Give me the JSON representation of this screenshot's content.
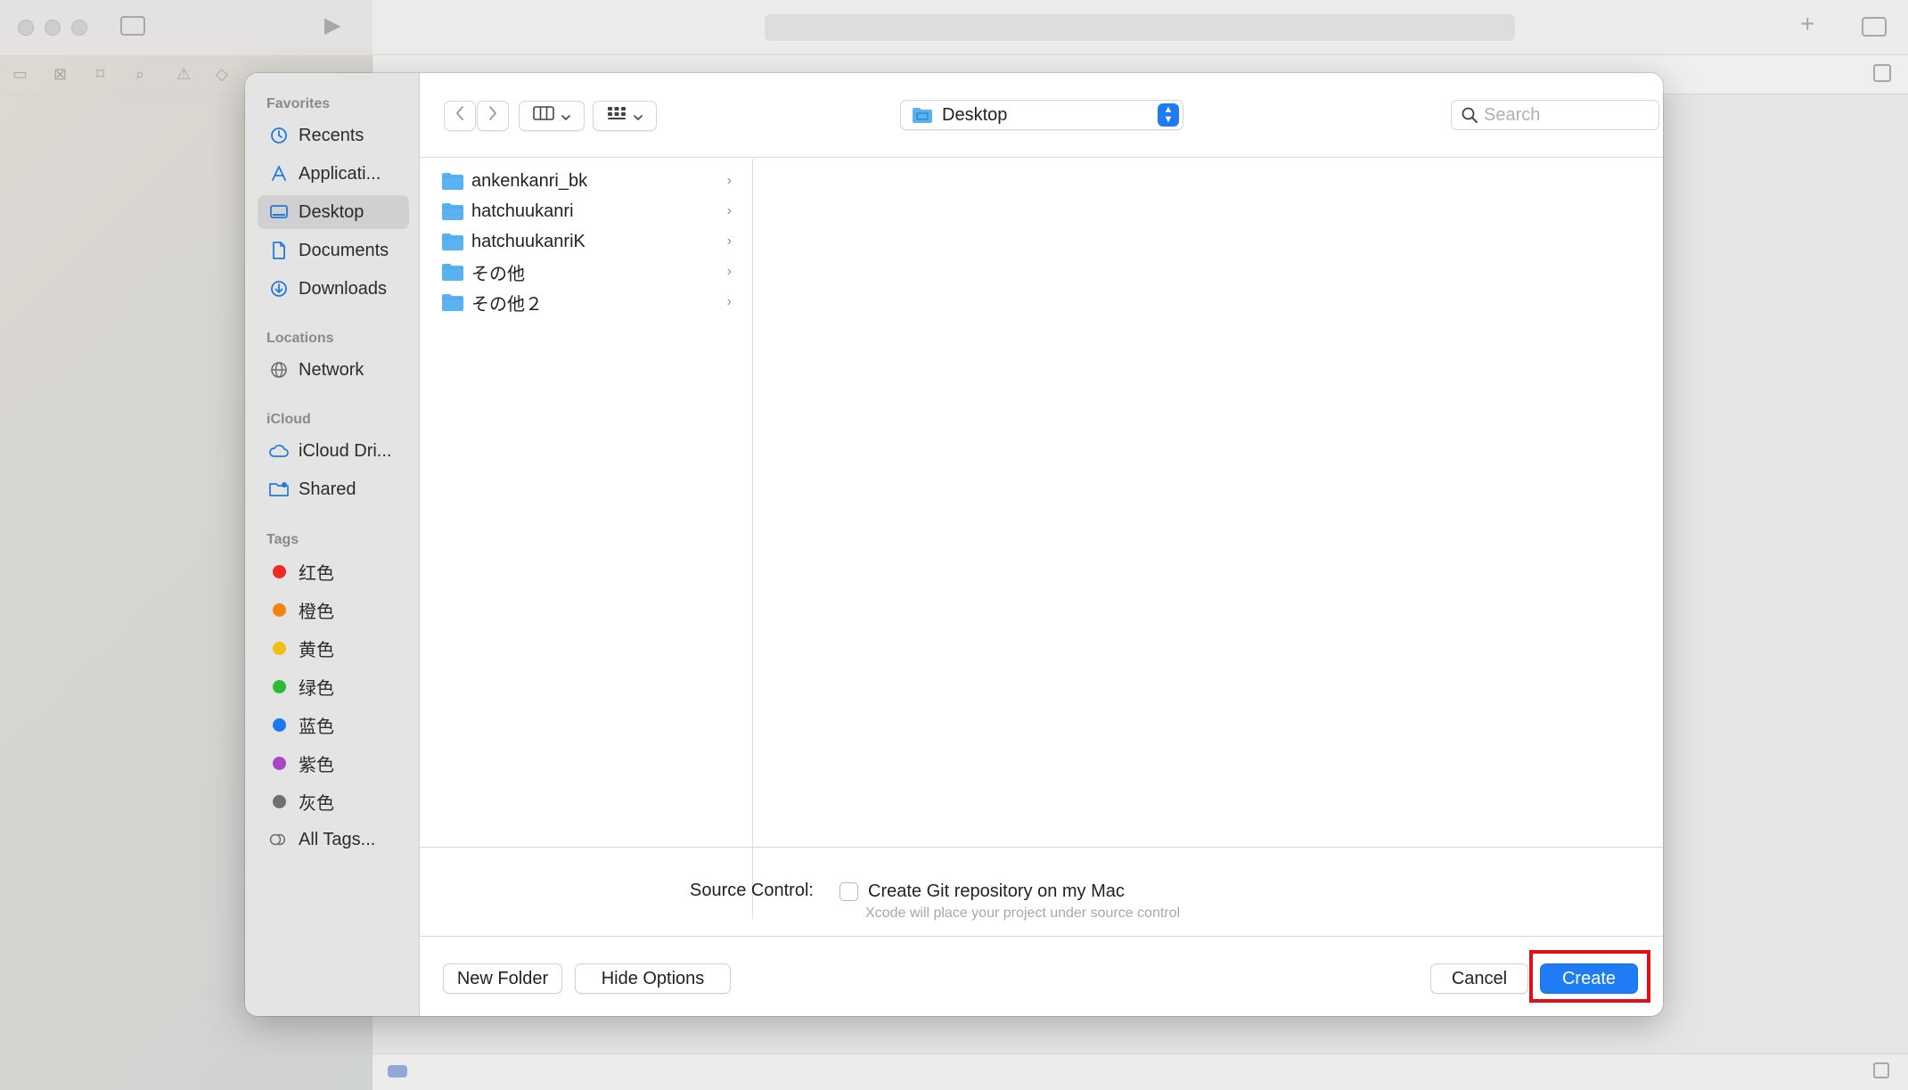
{
  "dialog": {
    "sidebar": {
      "sections": [
        {
          "title": "Favorites",
          "items": [
            {
              "label": "Recents",
              "icon": "clock-icon"
            },
            {
              "label": "Applicati...",
              "icon": "applications-icon"
            },
            {
              "label": "Desktop",
              "icon": "desktop-icon",
              "selected": true
            },
            {
              "label": "Documents",
              "icon": "document-icon"
            },
            {
              "label": "Downloads",
              "icon": "download-icon"
            }
          ]
        },
        {
          "title": "Locations",
          "items": [
            {
              "label": "Network",
              "icon": "globe-icon"
            }
          ]
        },
        {
          "title": "iCloud",
          "items": [
            {
              "label": "iCloud Dri...",
              "icon": "cloud-icon"
            },
            {
              "label": "Shared",
              "icon": "shared-folder-icon"
            }
          ]
        },
        {
          "title": "Tags",
          "items": [
            {
              "label": "红色",
              "color": "#f02a1f"
            },
            {
              "label": "橙色",
              "color": "#f5820f"
            },
            {
              "label": "黄色",
              "color": "#f4bd16"
            },
            {
              "label": "绿色",
              "color": "#2dbb34"
            },
            {
              "label": "蓝色",
              "color": "#1a7af4"
            },
            {
              "label": "紫色",
              "color": "#a845c9"
            },
            {
              "label": "灰色",
              "color": "#707070"
            },
            {
              "label": "All Tags...",
              "icon": "all-tags-icon"
            }
          ]
        }
      ]
    },
    "toolbar": {
      "location": "Desktop",
      "search_placeholder": "Search"
    },
    "files": [
      {
        "name": "ankenkanri_bk"
      },
      {
        "name": "hatchuukanri"
      },
      {
        "name": "hatchuukanriK"
      },
      {
        "name": "その他"
      },
      {
        "name": "その他２"
      }
    ],
    "options": {
      "source_control_label": "Source Control:",
      "checkbox_label": "Create Git repository on my Mac",
      "checkbox_checked": false,
      "hint": "Xcode will place your project under source control"
    },
    "footer": {
      "new_folder": "New Folder",
      "hide_options": "Hide Options",
      "cancel": "Cancel",
      "create": "Create"
    }
  },
  "colors": {
    "accent": "#1f7cf4",
    "folder": "#5ab2f0",
    "highlight": "#e0101b"
  }
}
